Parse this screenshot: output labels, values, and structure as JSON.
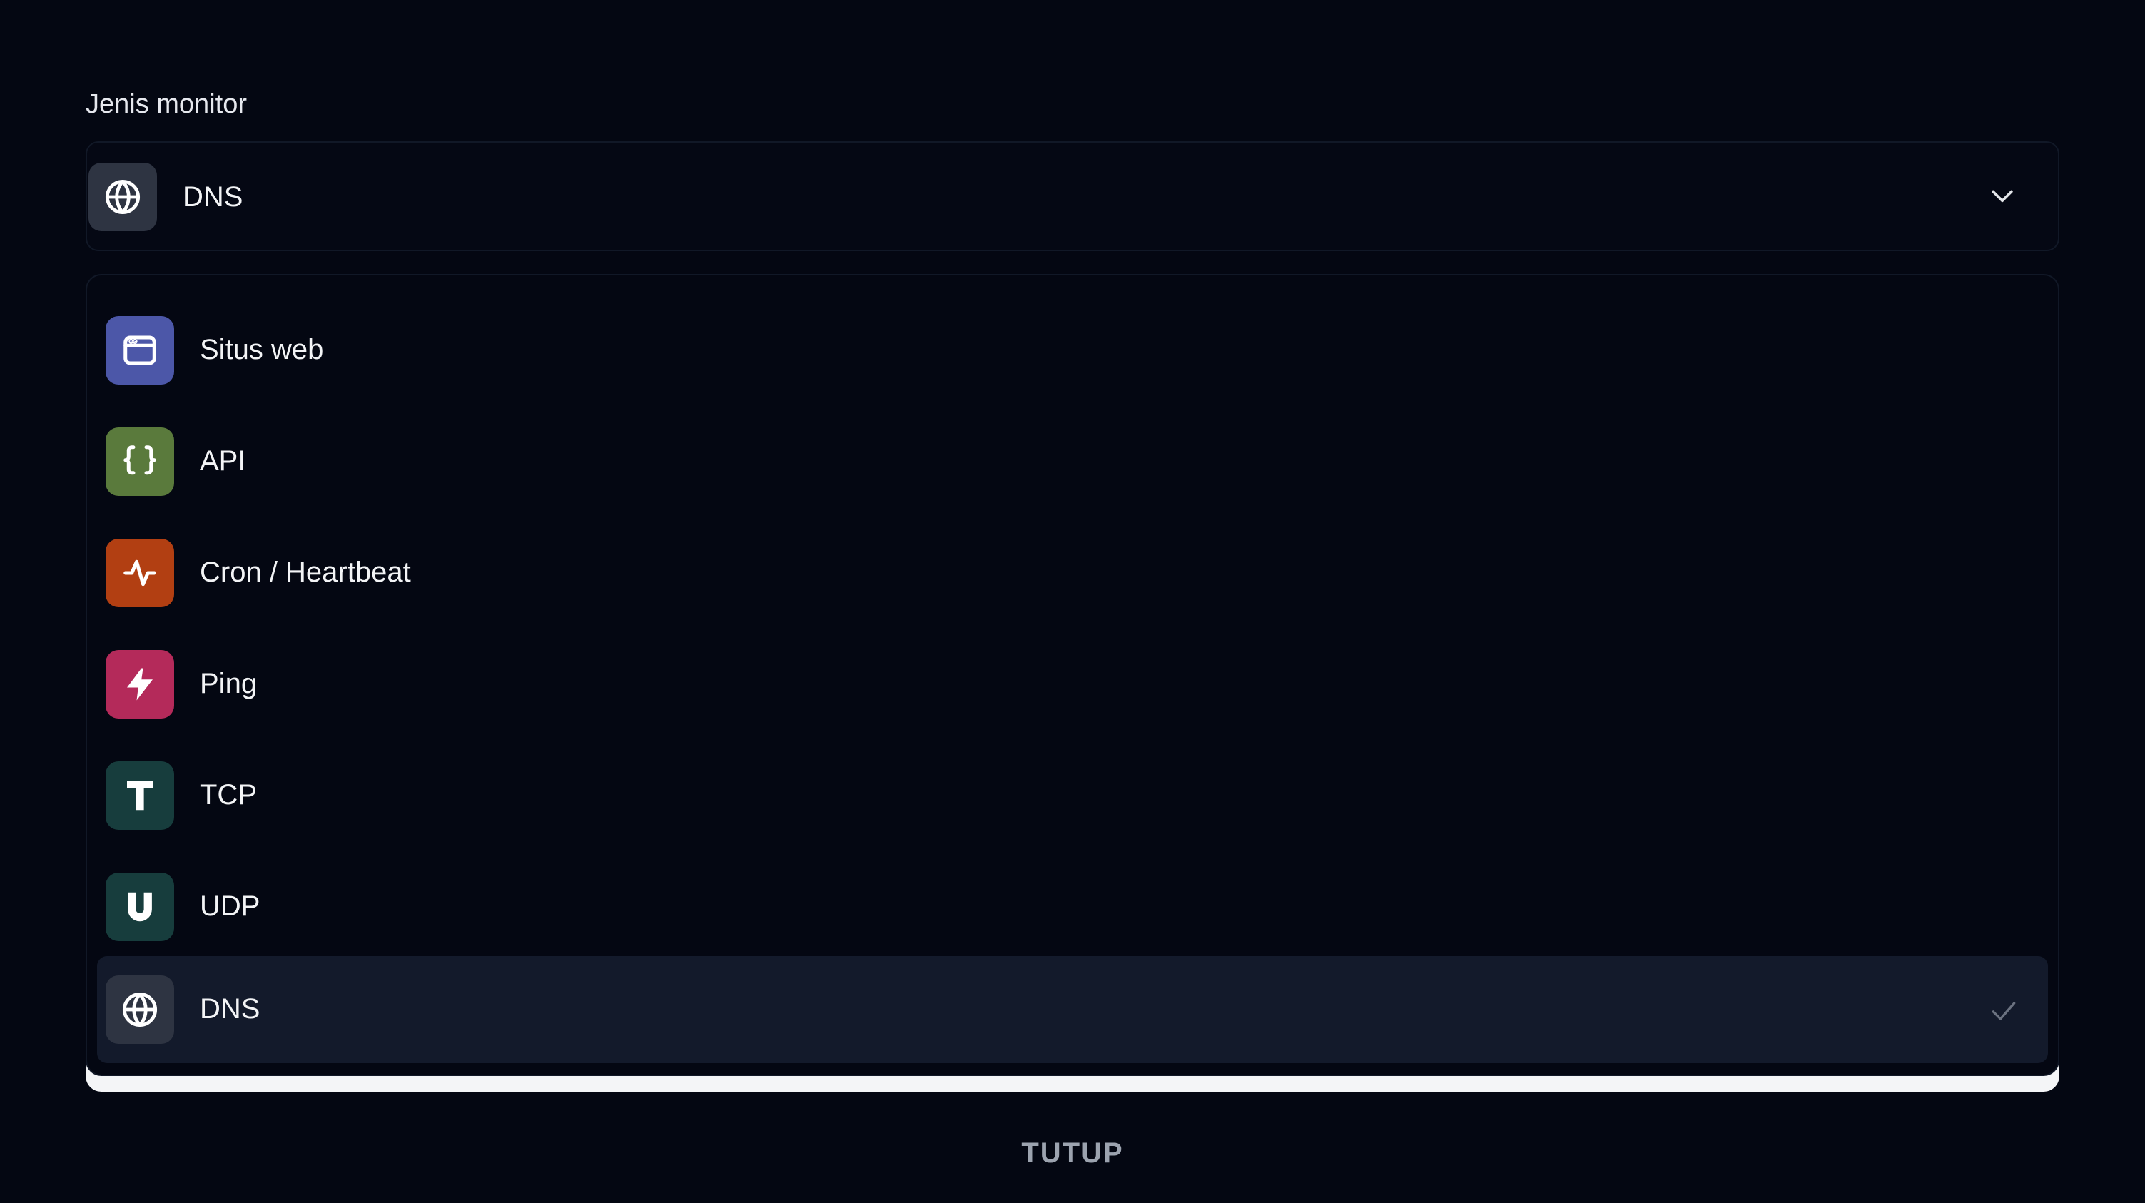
{
  "form": {
    "monitor_type_label": "Jenis monitor",
    "selected_value": "DNS",
    "selected_icon": "globe-icon",
    "submit_label": "TUTUP"
  },
  "dropdown": {
    "options": [
      {
        "label": "Situs web",
        "icon": "browser-window-icon",
        "color": "#4c57a8",
        "selected": false
      },
      {
        "label": "API",
        "icon": "curly-braces-icon",
        "color": "#5a7a3c",
        "selected": false
      },
      {
        "label": "Cron / Heartbeat",
        "icon": "activity-pulse-icon",
        "color": "#b23f12",
        "selected": false
      },
      {
        "label": "Ping",
        "icon": "lightning-bolt-icon",
        "color": "#b42a5a",
        "selected": false
      },
      {
        "label": "TCP",
        "icon": "letter-t-icon",
        "color": "#173d3d",
        "selected": false
      },
      {
        "label": "UDP",
        "icon": "letter-u-icon",
        "color": "#173d3d",
        "selected": false
      },
      {
        "label": "DNS",
        "icon": "globe-icon",
        "color": "#2e3442",
        "selected": true
      }
    ]
  },
  "colors": {
    "background": "#040712",
    "selected_row": "#131a2b",
    "border": "#111827",
    "muted_text": "#9ca3af"
  }
}
